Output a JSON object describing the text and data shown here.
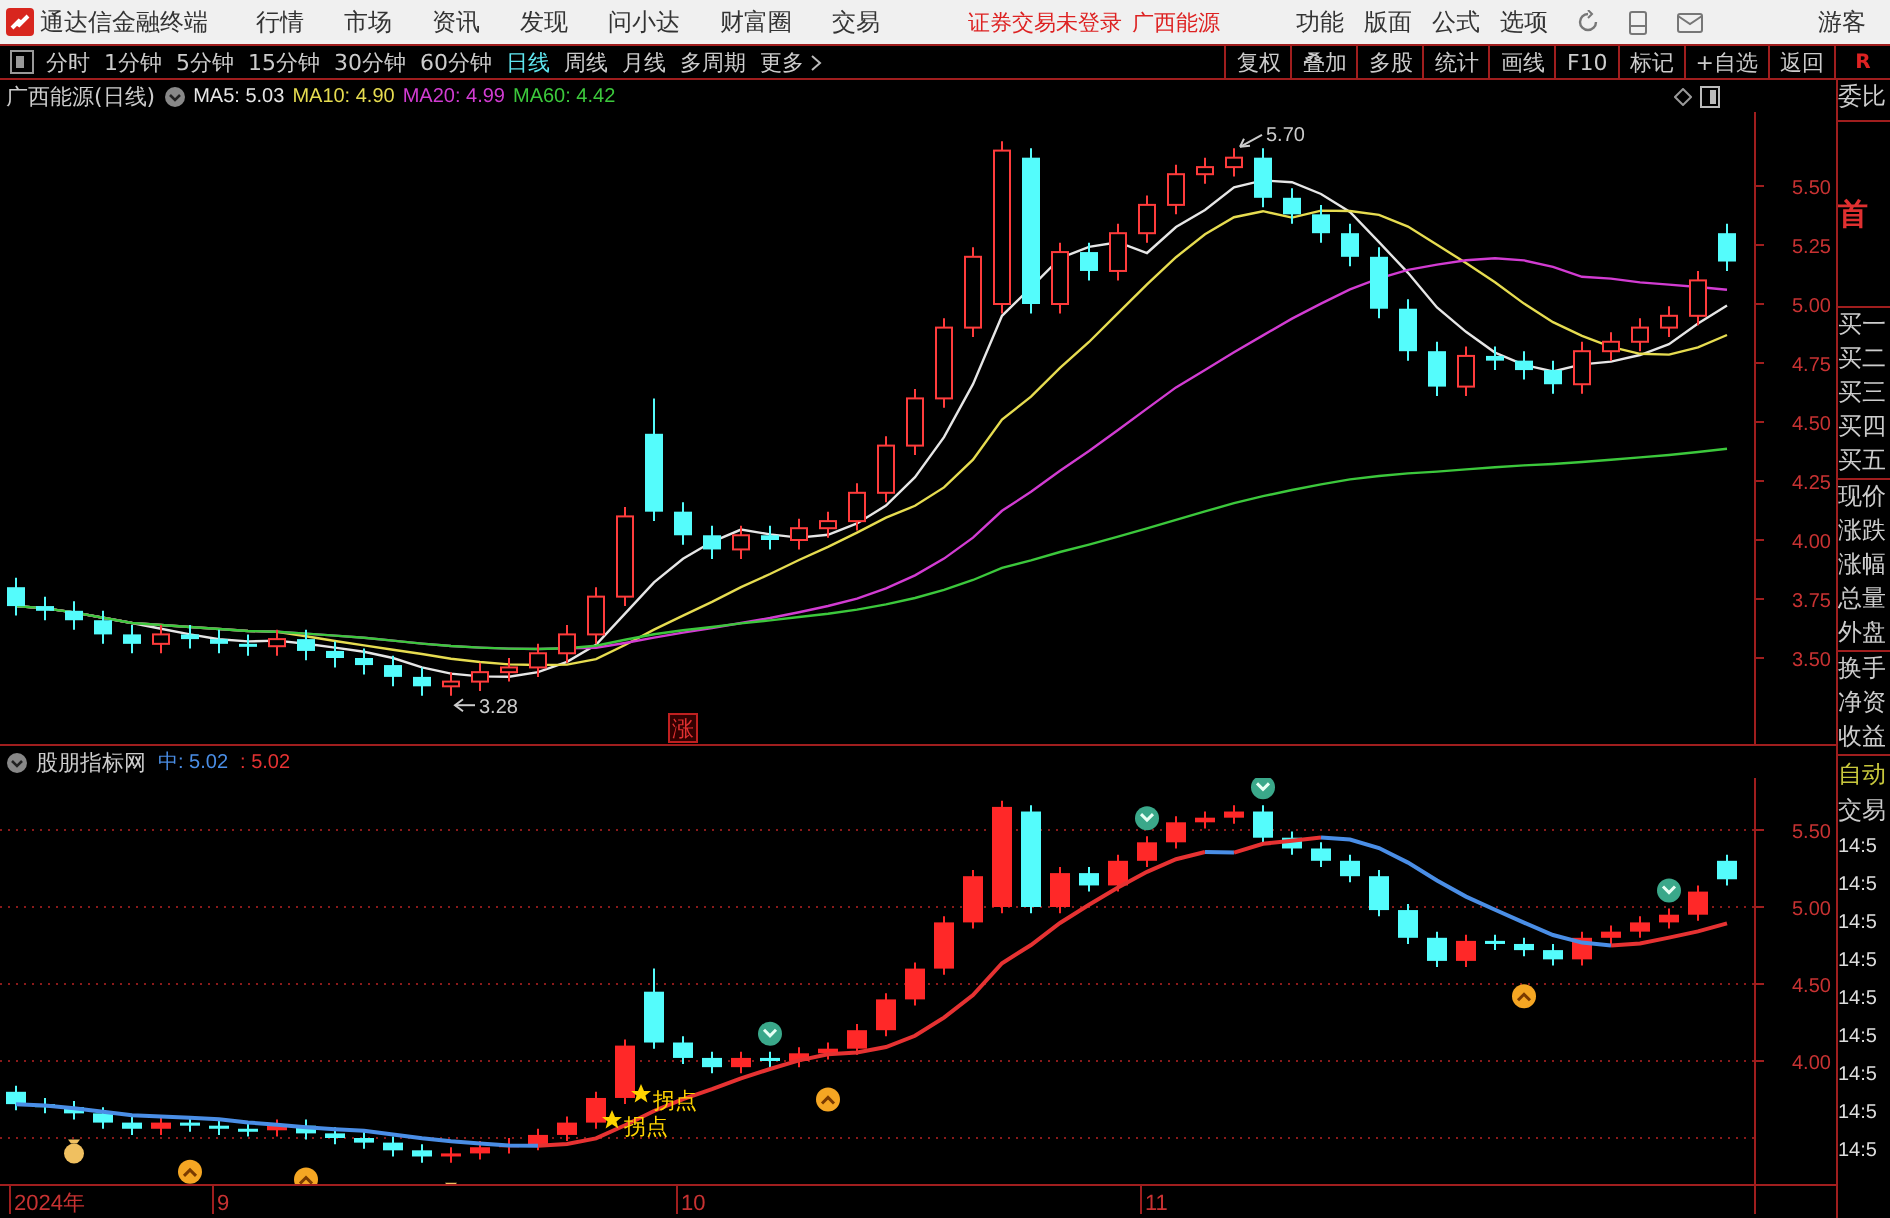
{
  "title_bar": {
    "app_name": "通达信金融终端",
    "menus": [
      "行情",
      "市场",
      "资讯",
      "发现",
      "问小达",
      "财富圈",
      "交易"
    ],
    "notice": "证券交易未登录",
    "stock_link": "广西能源",
    "tools": [
      "功能",
      "版面",
      "公式",
      "选项"
    ],
    "user": "游客"
  },
  "period_tabs": [
    {
      "label": "分时",
      "selected": false
    },
    {
      "label": "1分钟",
      "selected": false
    },
    {
      "label": "5分钟",
      "selected": false
    },
    {
      "label": "15分钟",
      "selected": false
    },
    {
      "label": "30分钟",
      "selected": false
    },
    {
      "label": "60分钟",
      "selected": false
    },
    {
      "label": "日线",
      "selected": true
    },
    {
      "label": "周线",
      "selected": false
    },
    {
      "label": "月线",
      "selected": false
    },
    {
      "label": "多周期",
      "selected": false
    },
    {
      "label": "更多",
      "selected": false
    }
  ],
  "toolbar_buttons": [
    "复权",
    "叠加",
    "多股",
    "统计",
    "画线",
    "F10",
    "标记",
    "+自选",
    "返回"
  ],
  "toolbar_badge": "R",
  "price_chart": {
    "title": "广西能源(日线)",
    "legend": [
      {
        "label": "MA5: 5.03",
        "color": "#e6e6e6"
      },
      {
        "label": "MA10: 4.90",
        "color": "#e6dc50"
      },
      {
        "label": "MA20: 4.99",
        "color": "#d23cd2"
      },
      {
        "label": "MA60: 4.42",
        "color": "#3cc83c"
      }
    ],
    "high_marker": "5.70",
    "low_marker": "3.28",
    "event_tag": "涨",
    "axis_labels": [
      "5.50",
      "5.25",
      "5.00",
      "4.75",
      "4.50",
      "4.25",
      "4.00",
      "3.75",
      "3.50"
    ]
  },
  "indicator_chart": {
    "title": "股朋指标网",
    "legend": [
      {
        "label": "中: 5.02",
        "color": "#4a8ee6"
      },
      {
        "label": ": 5.02",
        "color": "#e63232"
      }
    ],
    "signal_labels": [
      "拐点",
      "拐点"
    ],
    "axis_labels": [
      "5.50",
      "5.00",
      "4.50",
      "4.00"
    ]
  },
  "x_axis": [
    "2024年",
    "9",
    "10",
    "11"
  ],
  "side_panel": [
    [
      {
        "text": "委比",
        "kind": "label"
      }
    ],
    [
      {
        "text": "首",
        "kind": "highlight"
      }
    ],
    [
      {
        "text": "买一",
        "kind": "label"
      },
      {
        "text": "买二",
        "kind": "label"
      },
      {
        "text": "买三",
        "kind": "label"
      },
      {
        "text": "买四",
        "kind": "label"
      },
      {
        "text": "买五",
        "kind": "label"
      }
    ],
    [
      {
        "text": "现价",
        "kind": "label"
      },
      {
        "text": "涨跌",
        "kind": "label"
      },
      {
        "text": "涨幅",
        "kind": "label"
      },
      {
        "text": "总量",
        "kind": "label"
      },
      {
        "text": "外盘",
        "kind": "label"
      }
    ],
    [
      {
        "text": "换手",
        "kind": "label"
      },
      {
        "text": "净资",
        "kind": "label"
      },
      {
        "text": "收益",
        "kind": "label"
      }
    ],
    [
      {
        "text": "自动",
        "kind": "status"
      },
      {
        "text": "交易",
        "kind": "label"
      },
      {
        "text": "14:5",
        "kind": "time"
      },
      {
        "text": "14:5",
        "kind": "time"
      },
      {
        "text": "14:5",
        "kind": "time"
      },
      {
        "text": "14:5",
        "kind": "time"
      },
      {
        "text": "14:5",
        "kind": "time"
      },
      {
        "text": "14:5",
        "kind": "time"
      },
      {
        "text": "14:5",
        "kind": "time"
      },
      {
        "text": "14:5",
        "kind": "time"
      },
      {
        "text": "14:5",
        "kind": "time"
      }
    ]
  ]
}
